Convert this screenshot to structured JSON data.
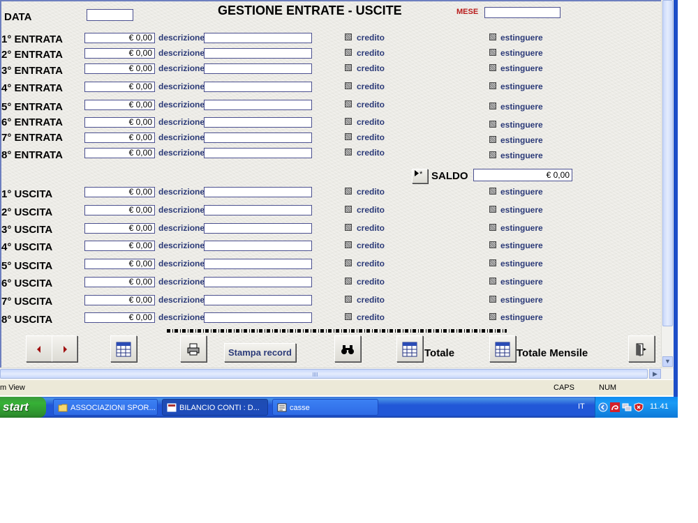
{
  "form": {
    "title": "GESTIONE ENTRATE - USCITE",
    "data_label": "DATA",
    "data_value": "",
    "mese_label": "MESE",
    "mese_value": "",
    "saldo_label": "SALDO",
    "saldo_value": "€ 0,00",
    "desc_label": "descrizione",
    "credito_label": "credito",
    "estinguere_label": "estinguere",
    "entrate": [
      {
        "label": "1° ENTRATA",
        "amount": "€ 0,00",
        "descrizione": ""
      },
      {
        "label": "2° ENTRATA",
        "amount": "€ 0,00",
        "descrizione": ""
      },
      {
        "label": "3° ENTRATA",
        "amount": "€ 0,00",
        "descrizione": ""
      },
      {
        "label": "4° ENTRATA",
        "amount": "€ 0,00",
        "descrizione": ""
      },
      {
        "label": "5° ENTRATA",
        "amount": "€ 0,00",
        "descrizione": ""
      },
      {
        "label": "6° ENTRATA",
        "amount": "€ 0,00",
        "descrizione": ""
      },
      {
        "label": "7° ENTRATA",
        "amount": "€ 0,00",
        "descrizione": ""
      },
      {
        "label": "8° ENTRATA",
        "amount": "€ 0,00",
        "descrizione": ""
      }
    ],
    "uscite": [
      {
        "label": "1° USCITA",
        "amount": "€ 0,00",
        "descrizione": ""
      },
      {
        "label": "2° USCITA",
        "amount": "€ 0,00",
        "descrizione": ""
      },
      {
        "label": "3° USCITA",
        "amount": "€ 0,00",
        "descrizione": ""
      },
      {
        "label": "4° USCITA",
        "amount": "€ 0,00",
        "descrizione": ""
      },
      {
        "label": "5° USCITA",
        "amount": "€ 0,00",
        "descrizione": ""
      },
      {
        "label": "6° USCITA",
        "amount": "€ 0,00",
        "descrizione": ""
      },
      {
        "label": "7° USCITA",
        "amount": "€ 0,00",
        "descrizione": ""
      },
      {
        "label": "8° USCITA",
        "amount": "€ 0,00",
        "descrizione": ""
      }
    ],
    "toolbar": {
      "stampa_label": "Stampa record",
      "totale_label": "Totale",
      "totale_mensile_label": "Totale Mensile"
    }
  },
  "statusbar": {
    "left": "m View",
    "caps": "CAPS",
    "num": "NUM"
  },
  "taskbar": {
    "start": "start",
    "tasks": [
      {
        "label": "ASSOCIAZIONI SPOR...",
        "icon": "folder-icon"
      },
      {
        "label": "BILANCIO CONTI : D...",
        "icon": "access-icon"
      },
      {
        "label": "casse",
        "icon": "form-icon"
      }
    ],
    "lang": "IT",
    "clock": "11.41"
  },
  "colors": {
    "form_bg": "#ecebe6",
    "label_blue": "#2b3a78",
    "mese_red": "#b81b1b",
    "taskbar_blue": "#2157d7",
    "start_green": "#36b136"
  }
}
